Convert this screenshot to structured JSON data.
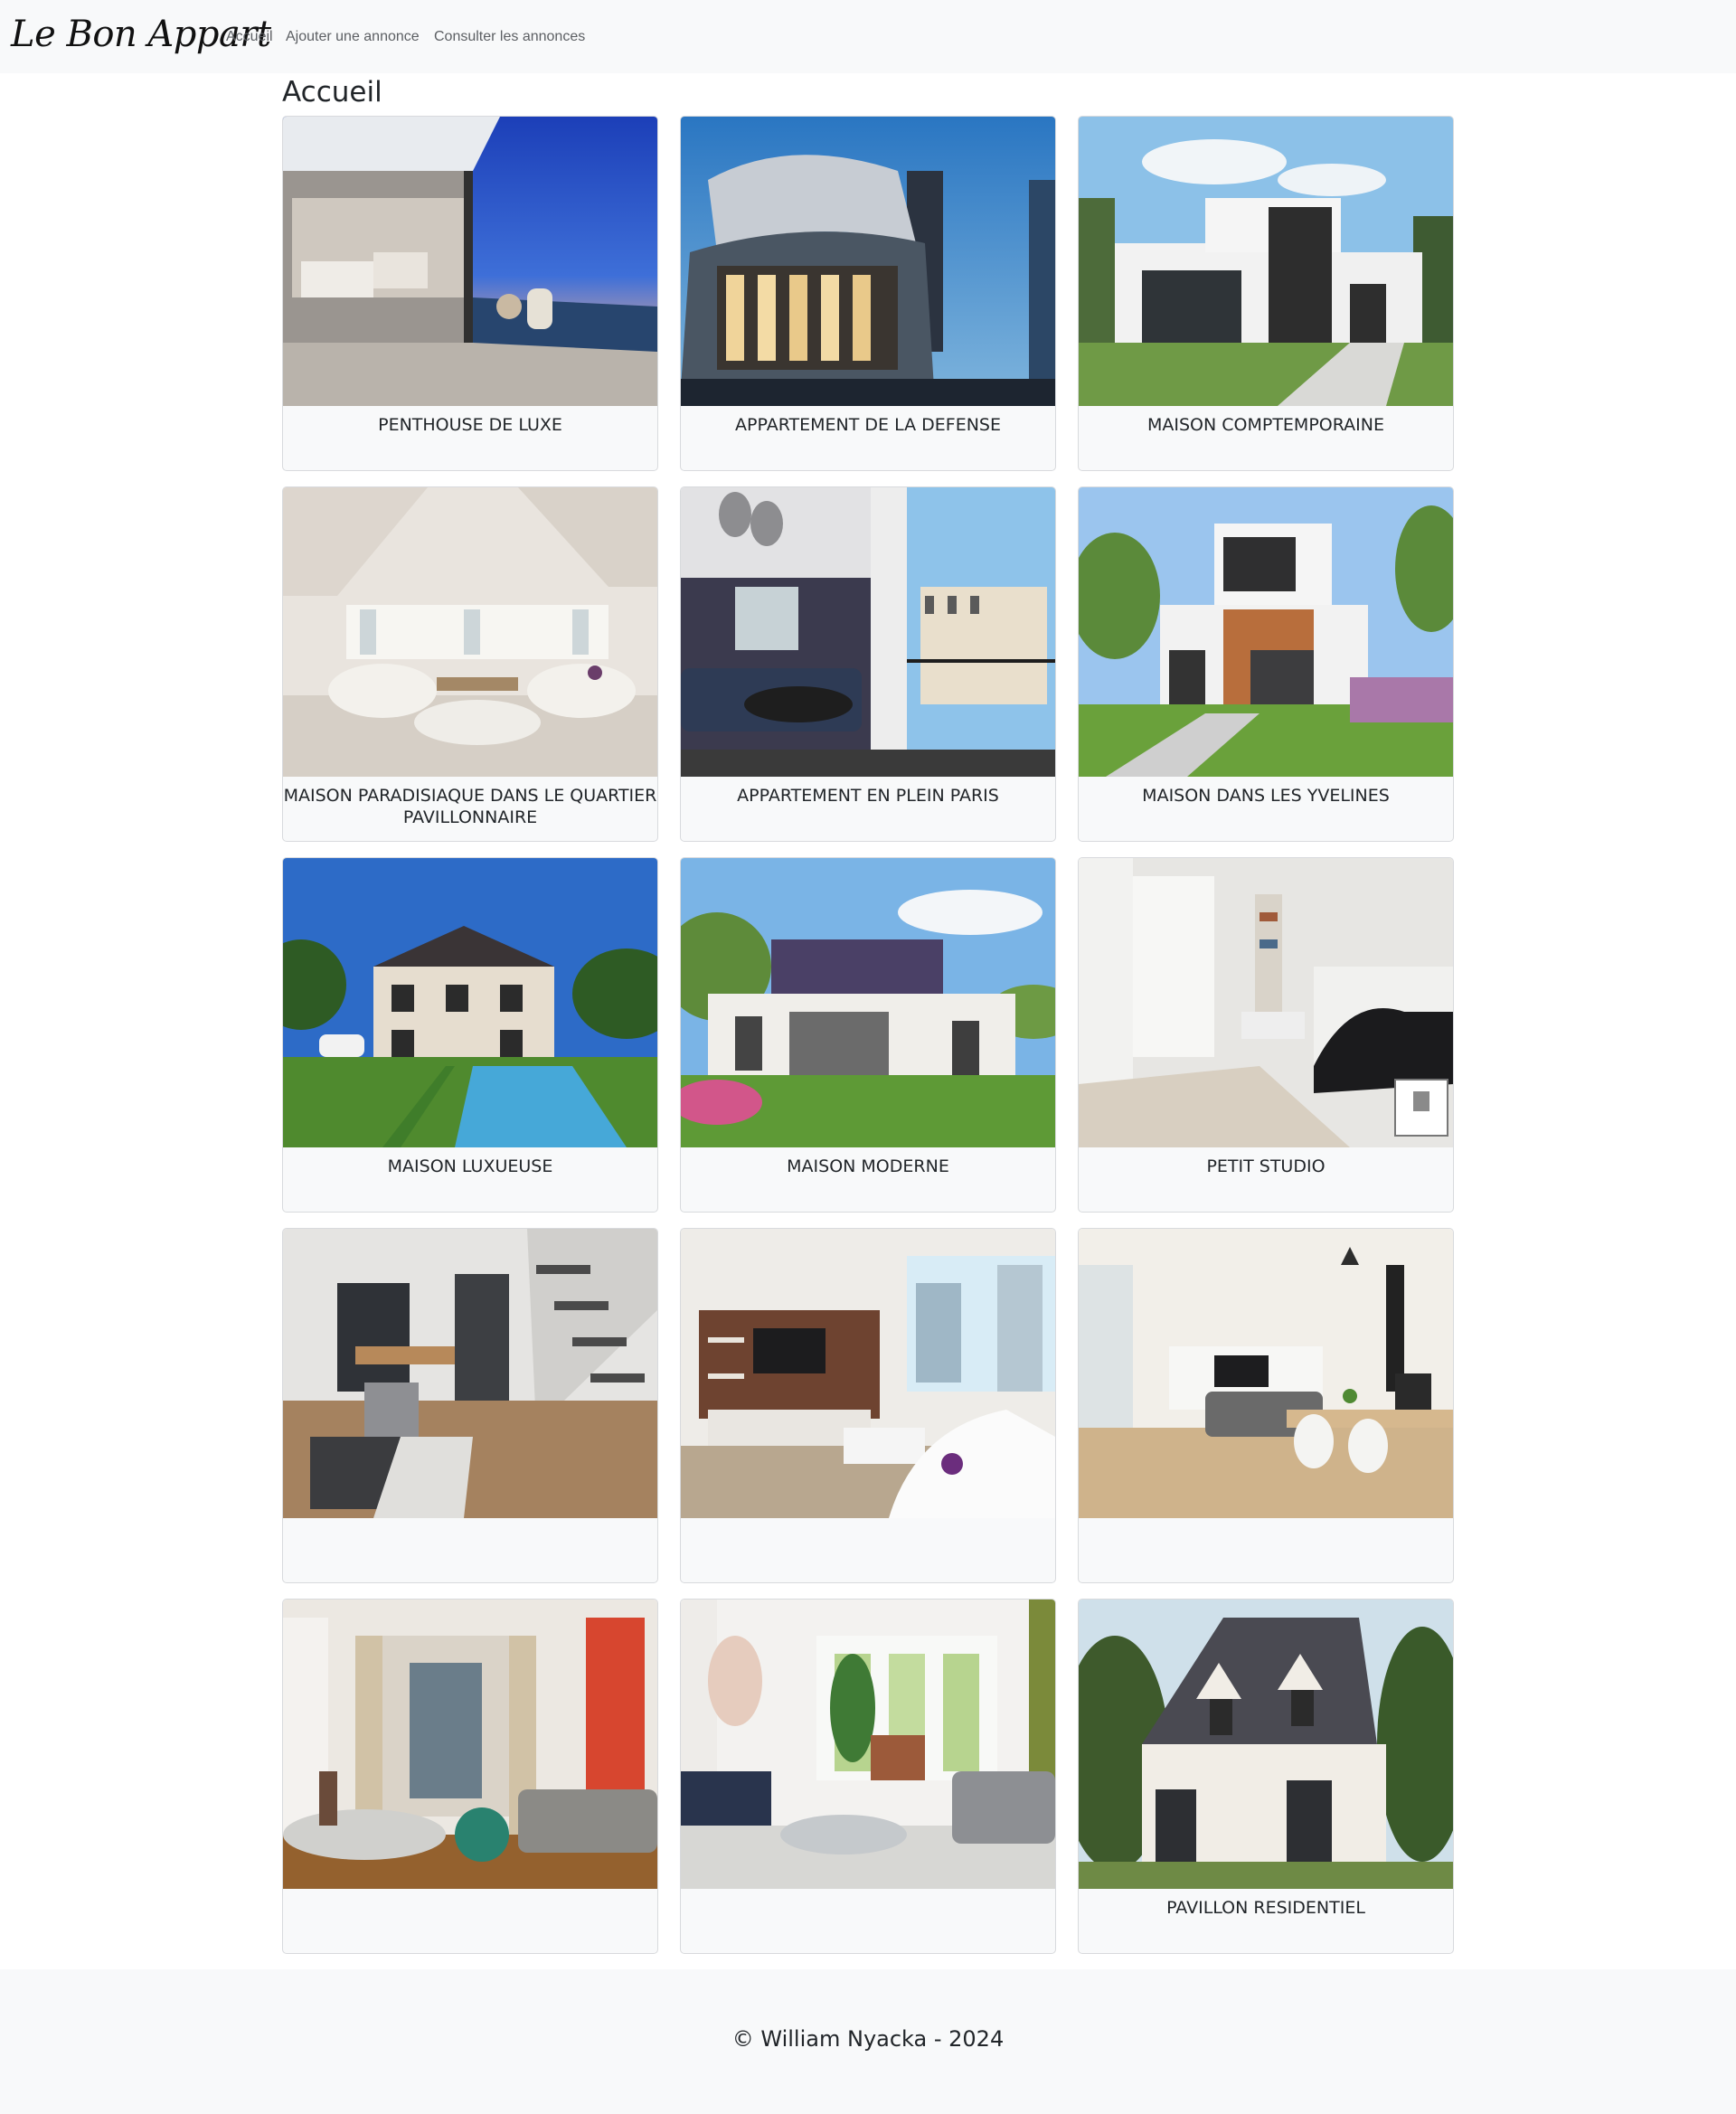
{
  "navbar": {
    "brand": "Le Bon Appart",
    "links": [
      "Accueil",
      "Ajouter une annonce",
      "Consulter les annonces"
    ]
  },
  "page": {
    "title": "Accueil"
  },
  "listings": [
    {
      "title": "PENTHOUSE DE LUXE",
      "image": "luxury-penthouse-terrace-photo"
    },
    {
      "title": "APPARTEMENT DE LA DEFENSE",
      "image": "modern-glass-building-photo"
    },
    {
      "title": "MAISON COMPTEMPORAINE",
      "image": "white-modern-house-photo"
    },
    {
      "title": "MAISON PARADISIAQUE DANS LE QUARTIER PAVILLONNAIRE",
      "image": "bright-living-room-photo"
    },
    {
      "title": "APPARTEMENT EN PLEIN PARIS",
      "image": "paris-apartment-balcony-photo"
    },
    {
      "title": "MAISON DANS LES YVELINES",
      "image": "modern-house-garden-photo"
    },
    {
      "title": "MAISON LUXUEUSE",
      "image": "house-with-pool-photo"
    },
    {
      "title": "MAISON MODERNE",
      "image": "modern-house-lawn-photo"
    },
    {
      "title": "PETIT STUDIO",
      "image": "small-studio-room-photo"
    },
    {
      "title": "",
      "image": "loft-staircase-living-photo"
    },
    {
      "title": "",
      "image": "living-room-tv-wall-photo"
    },
    {
      "title": "",
      "image": "dining-living-room-photo"
    },
    {
      "title": "",
      "image": "haussmann-living-room-photo"
    },
    {
      "title": "",
      "image": "living-dining-plants-photo"
    },
    {
      "title": "PAVILLON RESIDENTIEL",
      "image": "residential-pavilion-photo"
    }
  ],
  "footer": {
    "text": "© William Nyacka - 2024"
  }
}
